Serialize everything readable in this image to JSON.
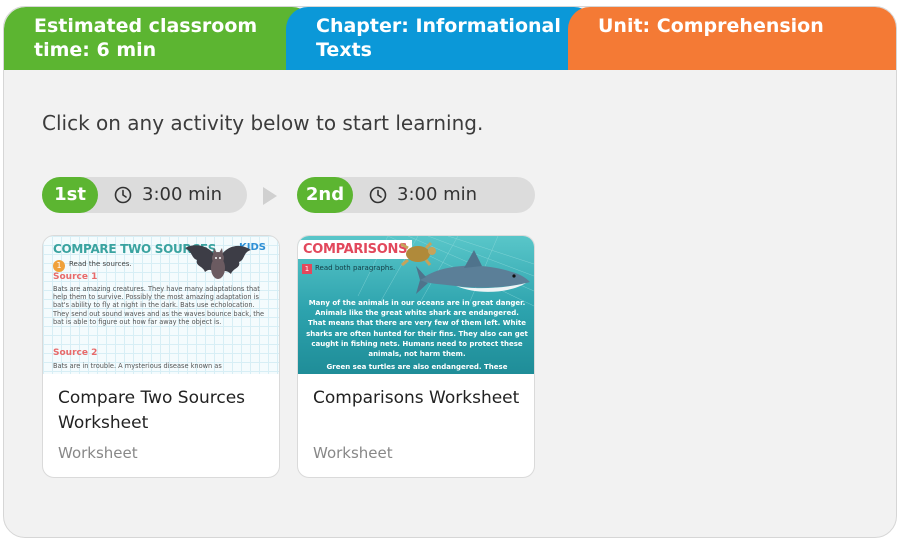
{
  "header": {
    "time_label": "Estimated classroom time: 6 min",
    "chapter_label": "Chapter: Informational Texts",
    "unit_label": "Unit: Comprehension"
  },
  "instruction": "Click on any activity below to start learning.",
  "steps": [
    {
      "badge": "1st",
      "time": "3:00 min"
    },
    {
      "badge": "2nd",
      "time": "3:00 min"
    }
  ],
  "cards": [
    {
      "title": "Compare Two Sources Worksheet",
      "type": "Worksheet",
      "thumb": {
        "heading": "COMPARE TWO SOURCES",
        "brand": "KIDS",
        "step": "1",
        "instruction": "Read the sources.",
        "source1": "Source 1",
        "source1_text": "Bats are amazing creatures. They have many adaptations that help them to survive. Possibly the most amazing adaptation is bat's ability to fly at night in the dark. Bats use echolocation. They send out sound waves and as the waves bounce back, the bat is able to figure out how far away the object is.",
        "source2": "Source 2",
        "source2_text": "Bats are in trouble. A mysterious disease known as"
      }
    },
    {
      "title": "Comparisons Worksheet",
      "type": "Worksheet",
      "thumb": {
        "heading": "COMPARISONS",
        "step": "1",
        "instruction": "Read both paragraphs.",
        "paragraph": "Many of the animals in our oceans are in great danger. Animals like the great white shark are endangered. That means that there are very few of them left. White sharks are often hunted for their fins. They also can get caught in fishing nets. Humans need to protect these animals, not harm them.",
        "paragraph2": "Green sea turtles are also endangered. These"
      }
    }
  ],
  "colors": {
    "green": "#5cb531",
    "blue": "#0b98d8",
    "orange": "#f47a35"
  },
  "icons": [
    "clock-icon",
    "arrow-right-icon",
    "bat-illustration",
    "shark-illustration",
    "turtle-illustration"
  ]
}
